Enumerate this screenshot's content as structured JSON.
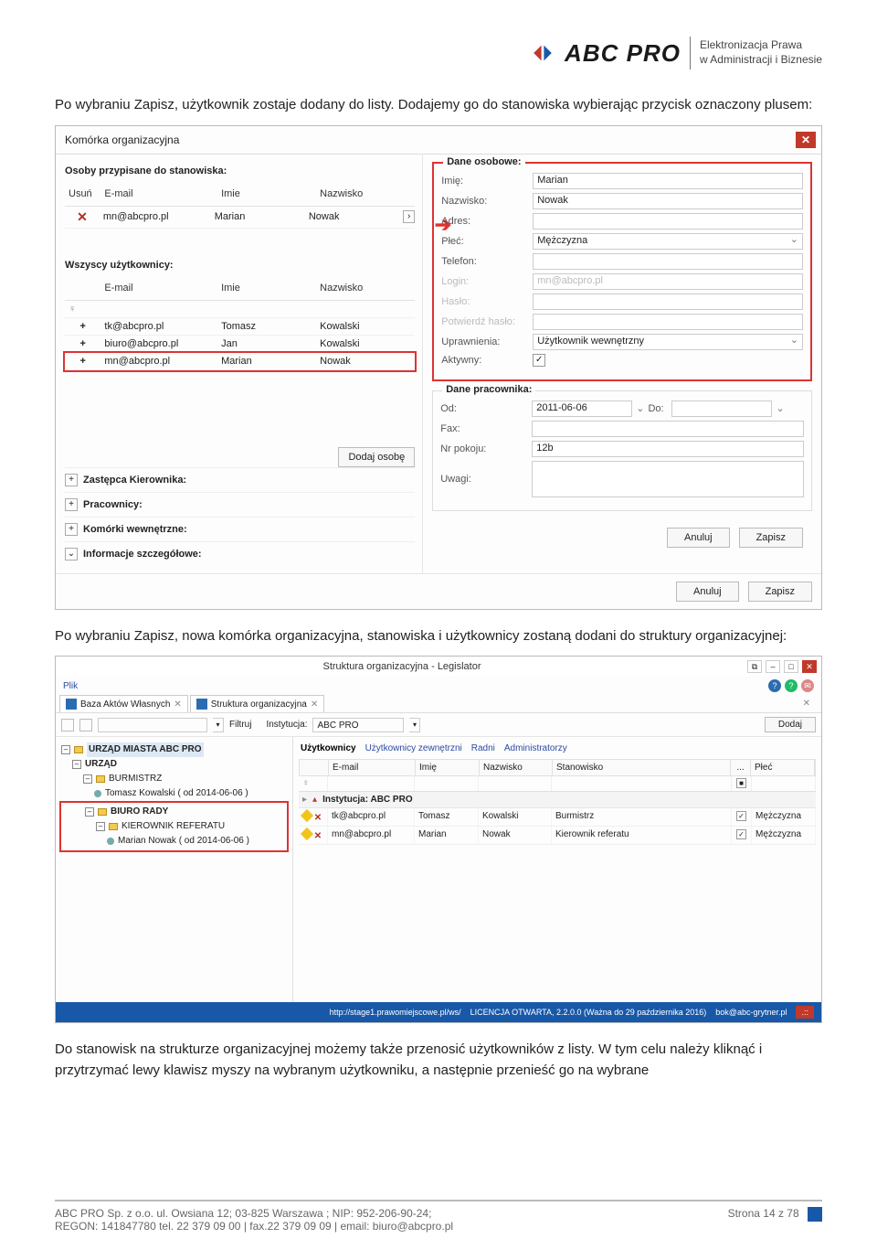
{
  "header": {
    "brand": "ABC PRO",
    "tagline1": "Elektronizacja Prawa",
    "tagline2": "w Administracji i Biznesie"
  },
  "para1": "Po wybraniu Zapisz, użytkownik zostaje dodany do listy. Dodajemy go do stanowiska wybierając przycisk oznaczony plusem:",
  "dialog": {
    "title": "Komórka organizacyjna",
    "assignedHeader": "Osoby przypisane do stanowiska:",
    "cols": {
      "usun": "Usuń",
      "email": "E-mail",
      "imie": "Imie",
      "nazw": "Nazwisko"
    },
    "assignedRow": {
      "email": "mn@abcpro.pl",
      "imie": "Marian",
      "nazw": "Nowak"
    },
    "allUsersHeader": "Wszyscy użytkownicy:",
    "users": [
      {
        "email": "tk@abcpro.pl",
        "imie": "Tomasz",
        "nazw": "Kowalski"
      },
      {
        "email": "biuro@abcpro.pl",
        "imie": "Jan",
        "nazw": "Kowalski"
      },
      {
        "email": "mn@abcpro.pl",
        "imie": "Marian",
        "nazw": "Nowak"
      }
    ],
    "addPerson": "Dodaj osobę",
    "expanders": {
      "zk": "Zastępca Kierownika:",
      "prac": "Pracownicy:",
      "kom": "Komórki wewnętrzne:",
      "info": "Informacje szczegółowe:"
    },
    "personal": {
      "legend": "Dane osobowe:",
      "imieL": "Imię:",
      "imieV": "Marian",
      "nazwL": "Nazwisko:",
      "nazwV": "Nowak",
      "adresL": "Adres:",
      "plecL": "Płeć:",
      "plecV": "Mężczyzna",
      "telL": "Telefon:",
      "loginL": "Login:",
      "loginV": "mn@abcpro.pl",
      "hasloL": "Hasło:",
      "phasloL": "Potwierdź hasło:",
      "uprL": "Uprawnienia:",
      "uprV": "Użytkownik wewnętrzny",
      "aktL": "Aktywny:"
    },
    "worker": {
      "legend": "Dane pracownika:",
      "odL": "Od:",
      "odV": "2011-06-06",
      "doL": "Do:",
      "faxL": "Fax:",
      "nrL": "Nr pokoju:",
      "nrV": "12b",
      "uwL": "Uwagi:"
    },
    "anuluj": "Anuluj",
    "zapisz": "Zapisz"
  },
  "para2": "Po wybraniu Zapisz, nowa komórka organizacyjna, stanowiska i użytkownicy zostaną dodani do struktury organizacyjnej:",
  "app": {
    "title": "Struktura organizacyjna - Legislator",
    "menu": "Plik",
    "tab1": "Baza Aktów Własnych",
    "tab2": "Struktura organizacyjna",
    "filtruj": "Filtruj",
    "instL": "Instytucja:",
    "instV": "ABC PRO",
    "dodaj": "Dodaj",
    "cats": {
      "u": "Użytkownicy",
      "uz": "Użytkownicy zewnętrzni",
      "r": "Radni",
      "a": "Administratorzy"
    },
    "gcols": {
      "email": "E-mail",
      "imie": "Imię",
      "nazw": "Nazwisko",
      "stan": "Stanowisko",
      "dots": "...",
      "plec": "Płeć"
    },
    "group": "Instytucja: ABC PRO",
    "rows": [
      {
        "email": "tk@abcpro.pl",
        "imie": "Tomasz",
        "nazw": "Kowalski",
        "stan": "Burmistrz",
        "plec": "Mężczyzna"
      },
      {
        "email": "mn@abcpro.pl",
        "imie": "Marian",
        "nazw": "Nowak",
        "stan": "Kierownik referatu",
        "plec": "Mężczyzna"
      }
    ],
    "tree": {
      "root": "URZĄD MIASTA ABC PRO",
      "n1": "URZĄD",
      "n2": "BURMISTRZ",
      "n3": "Tomasz Kowalski ( od 2014-06-06 )",
      "n4": "BIURO RADY",
      "n5": "KIEROWNIK REFERATU",
      "n6": "Marian Nowak ( od 2014-06-06 )"
    },
    "status1": "http://stage1.prawomiejscowe.pl/ws/",
    "status2": "LICENCJA OTWARTA, 2.2.0.0 (Ważna do 29 października 2016)",
    "status3": "bok@abc-grytner.pl"
  },
  "para3": "Do stanowisk na strukturze organizacyjnej możemy także przenosić użytkowników z listy. W tym celu należy kliknąć i przytrzymać lewy klawisz myszy na wybranym użytkowniku, a następnie przenieść go na wybrane",
  "footer": {
    "l1": "ABC PRO Sp. z o.o. ul. Owsiana 12;  03-825 Warszawa ; NIP: 952-206-90-24;",
    "l2": "REGON: 141847780 tel. 22 379 09 00 | fax.22 379 09 09 | email: biuro@abcpro.pl",
    "page": "Strona 14 z 78"
  }
}
